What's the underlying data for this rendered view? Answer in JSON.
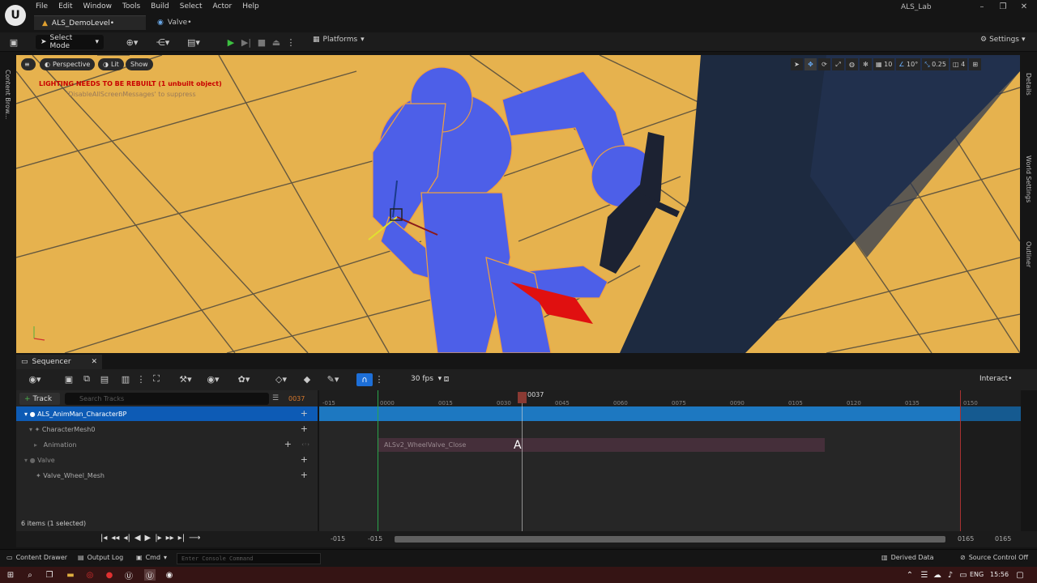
{
  "app": {
    "menu": [
      "File",
      "Edit",
      "Window",
      "Tools",
      "Build",
      "Select",
      "Actor",
      "Help"
    ],
    "tabs": [
      {
        "label": "ALS_DemoLevel•",
        "active": true
      },
      {
        "label": "Valve•",
        "active": false
      }
    ],
    "project": "ALS_Lab"
  },
  "toolbar": {
    "select_mode": "Select Mode",
    "platforms": "Platforms",
    "settings": "Settings"
  },
  "sidebars": {
    "left": "Content Brow...",
    "right": [
      "Details",
      "World Settings",
      "Outliner"
    ]
  },
  "viewport": {
    "perspective": "Perspective",
    "lit": "Lit",
    "show": "Show",
    "warning": "LIGHTING NEEDS TO BE REBUILT (1 unbuilt object)",
    "hint": "'DisableAllScreenMessages' to suppress",
    "grid_size": "10",
    "rotation_snap": "10°",
    "scale_snap": "0.25",
    "camera_speed": "4",
    "colors": {
      "floor": "#e6b24e",
      "character": "#4d5fe8",
      "pillar": "#1d2a40"
    }
  },
  "sequencer": {
    "tab": "Sequencer",
    "fps": "30 fps",
    "interact": "Interact•",
    "track_button": "Track",
    "search_placeholder": "Search Tracks",
    "current_frame": "0037",
    "tracks": [
      {
        "label": "ALS_AnimMan_CharacterBP",
        "selected": true
      },
      {
        "label": "CharacterMesh0",
        "selected": false
      },
      {
        "label": "Animation",
        "selected": false
      },
      {
        "label": "Valve",
        "selected": false
      },
      {
        "label": "Valve_Wheel_Mesh",
        "selected": false
      }
    ],
    "item_count": "6 items (1 selected)",
    "ruler": [
      "-015",
      "0000",
      "0015",
      "0030",
      "0045",
      "0060",
      "0075",
      "0090",
      "0105",
      "0120",
      "0135",
      "0150"
    ],
    "section": "ALSv2_WheelValve_Close",
    "key_marker": "A",
    "transport": {
      "view_start": "-015",
      "work_start": "-015",
      "work_end": "0165",
      "view_end": "0165"
    }
  },
  "status": {
    "content_drawer": "Content Drawer",
    "output_log": "Output Log",
    "cmd": "Cmd",
    "console_placeholder": "Enter Console Command",
    "derived_data": "Derived Data",
    "source_control": "Source Control Off"
  },
  "taskbar": {
    "lang": "ENG",
    "time": "15:56"
  }
}
